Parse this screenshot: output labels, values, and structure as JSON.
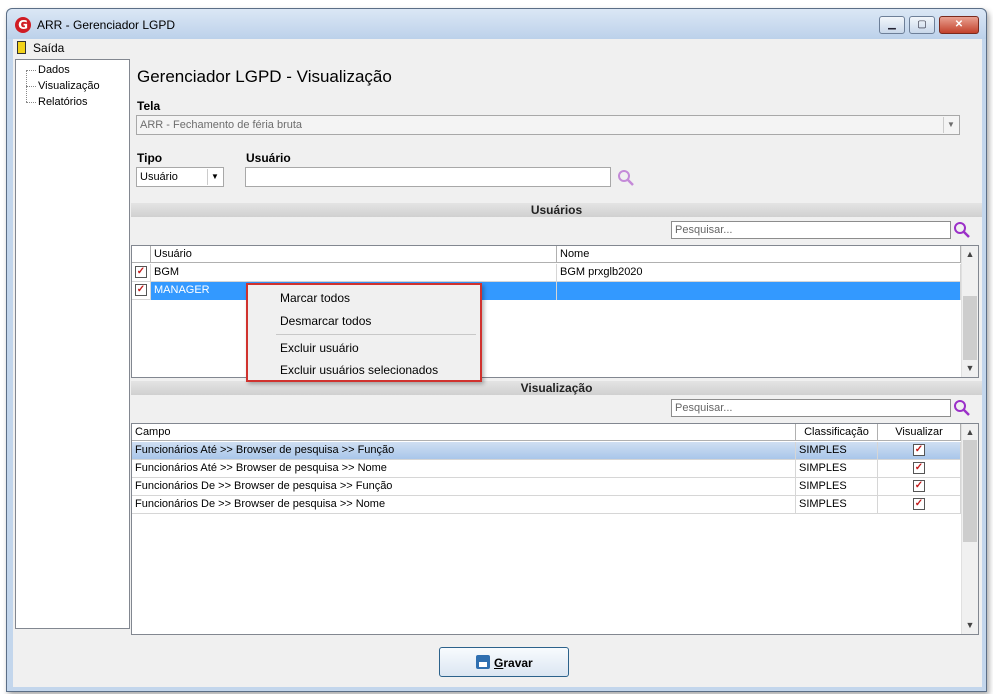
{
  "window": {
    "title": "ARR - Gerenciador LGPD",
    "app_icon": "G"
  },
  "menu": {
    "exit": "Saída"
  },
  "tree": {
    "items": [
      "Dados",
      "Visualização",
      "Relatórios"
    ]
  },
  "page": {
    "title": "Gerenciador LGPD - Visualização"
  },
  "tela": {
    "label": "Tela",
    "value": "ARR - Fechamento de féria bruta"
  },
  "tipo": {
    "label": "Tipo",
    "value": "Usuário"
  },
  "usuario": {
    "label": "Usuário",
    "value": ""
  },
  "users_section": {
    "title": "Usuários",
    "search_placeholder": "Pesquisar...",
    "columns": [
      "Usuário",
      "Nome"
    ],
    "rows": [
      {
        "user": "BGM",
        "name": "BGM prxglb2020",
        "checked": true,
        "selected": false
      },
      {
        "user": "MANAGER",
        "name": "",
        "checked": true,
        "selected": true
      }
    ]
  },
  "context_menu": {
    "items": [
      "Marcar todos",
      "Desmarcar todos",
      "Excluir usuário",
      "Excluir usuários selecionados"
    ]
  },
  "view_section": {
    "title": "Visualização",
    "search_placeholder": "Pesquisar...",
    "columns": [
      "Campo",
      "Classificação",
      "Visualizar"
    ],
    "rows": [
      {
        "campo": "Funcionários Até >> Browser de pesquisa >> Função",
        "class": "SIMPLES",
        "visualizar": true
      },
      {
        "campo": "Funcionários Até >> Browser de pesquisa >> Nome",
        "class": "SIMPLES",
        "visualizar": true
      },
      {
        "campo": "Funcionários De >> Browser de pesquisa >> Função",
        "class": "SIMPLES",
        "visualizar": true
      },
      {
        "campo": "Funcionários De >> Browser de pesquisa >> Nome",
        "class": "SIMPLES",
        "visualizar": true
      }
    ]
  },
  "buttons": {
    "save_underlined": "G",
    "save_rest": "ravar"
  },
  "colors": {
    "selection": "#3399ff",
    "accent": "#9b30c8",
    "checkmark": "#c21b1b",
    "menu_border": "#d0322e"
  },
  "icons": {
    "search": "magnifier-icon",
    "save": "floppy-disk-icon",
    "exit": "exit-door-icon",
    "close": "close-icon"
  }
}
